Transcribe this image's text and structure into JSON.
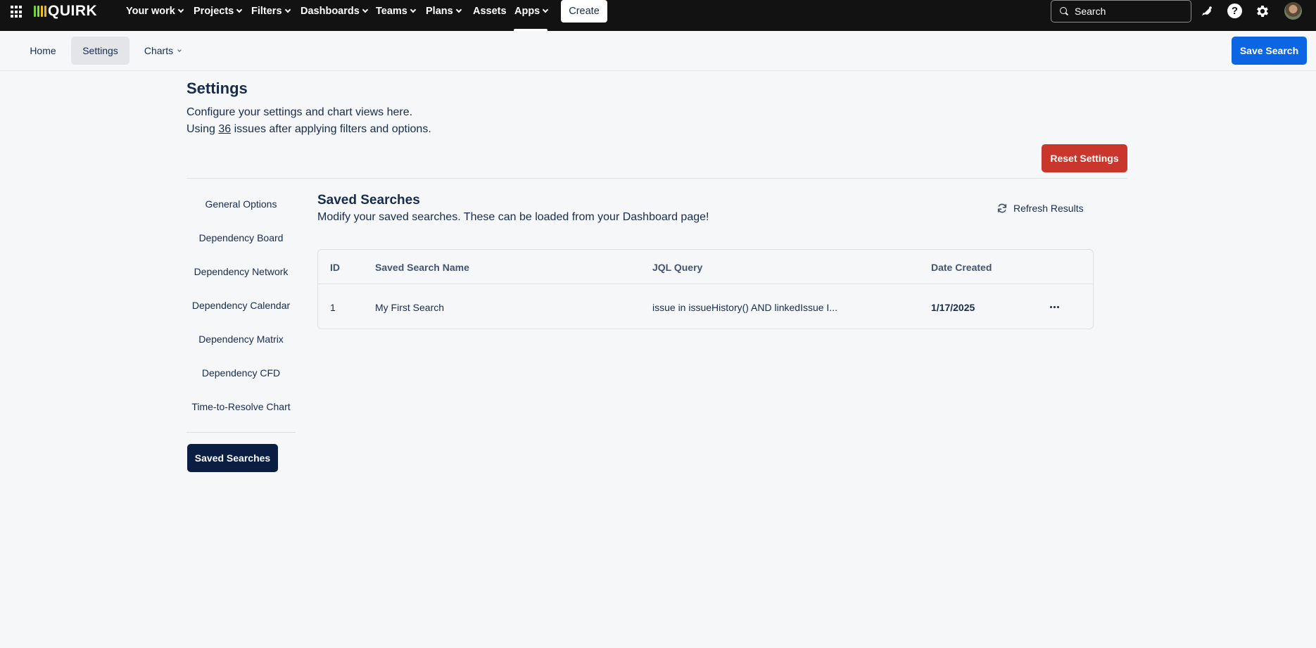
{
  "topnav": {
    "app_switcher_icon": "apps-grid-icon",
    "logo": {
      "text": "QUIRK",
      "mark_colors": [
        "#6fcf3f",
        "#9bd33a",
        "#e8c21c",
        "#f0b41a"
      ]
    },
    "items": [
      {
        "label": "Your work",
        "has_dropdown": true
      },
      {
        "label": "Projects",
        "has_dropdown": true
      },
      {
        "label": "Filters",
        "has_dropdown": true
      },
      {
        "label": "Dashboards",
        "has_dropdown": true
      },
      {
        "label": "Teams",
        "has_dropdown": true
      },
      {
        "label": "Plans",
        "has_dropdown": true
      },
      {
        "label": "Assets",
        "has_dropdown": false
      },
      {
        "label": "Apps",
        "has_dropdown": true,
        "active": true
      }
    ],
    "create_label": "Create",
    "search_placeholder": "Search",
    "icons": [
      "notifications-icon",
      "help-icon",
      "settings-gear-icon",
      "user-avatar"
    ],
    "help_glyph": "?"
  },
  "subnav": {
    "tabs": [
      {
        "label": "Home",
        "active": false
      },
      {
        "label": "Settings",
        "active": true
      },
      {
        "label": "Charts",
        "active": false,
        "has_dropdown": true
      }
    ],
    "save_search_label": "Save Search"
  },
  "page": {
    "title": "Settings",
    "description": "Configure your settings and chart views here.",
    "usage_prefix": "Using",
    "issue_count": "36",
    "usage_suffix": "issues after applying filters and options.",
    "reset_label": "Reset Settings"
  },
  "menu": {
    "items": [
      "General Options",
      "Dependency Board",
      "Dependency Network",
      "Dependency Calendar",
      "Dependency Matrix",
      "Dependency CFD",
      "Time-to-Resolve Chart"
    ],
    "active_label": "Saved Searches"
  },
  "saved_searches": {
    "title": "Saved Searches",
    "description": "Modify your saved searches. These can be loaded from your Dashboard page!",
    "refresh_label": "Refresh Results",
    "columns": [
      "ID",
      "Saved Search Name",
      "JQL Query",
      "Date Created"
    ],
    "rows": [
      {
        "id": "1",
        "name": "My First Search",
        "jql": "issue in issueHistory() AND linkedIssue I...",
        "date_created": "1/17/2025"
      }
    ]
  },
  "colors": {
    "topnav_bg": "#121212",
    "primary": "#0c66e4",
    "danger": "#c9372c",
    "active_menu": "#091e42",
    "text": "#172b4d",
    "page_bg": "#f6f7f9"
  }
}
